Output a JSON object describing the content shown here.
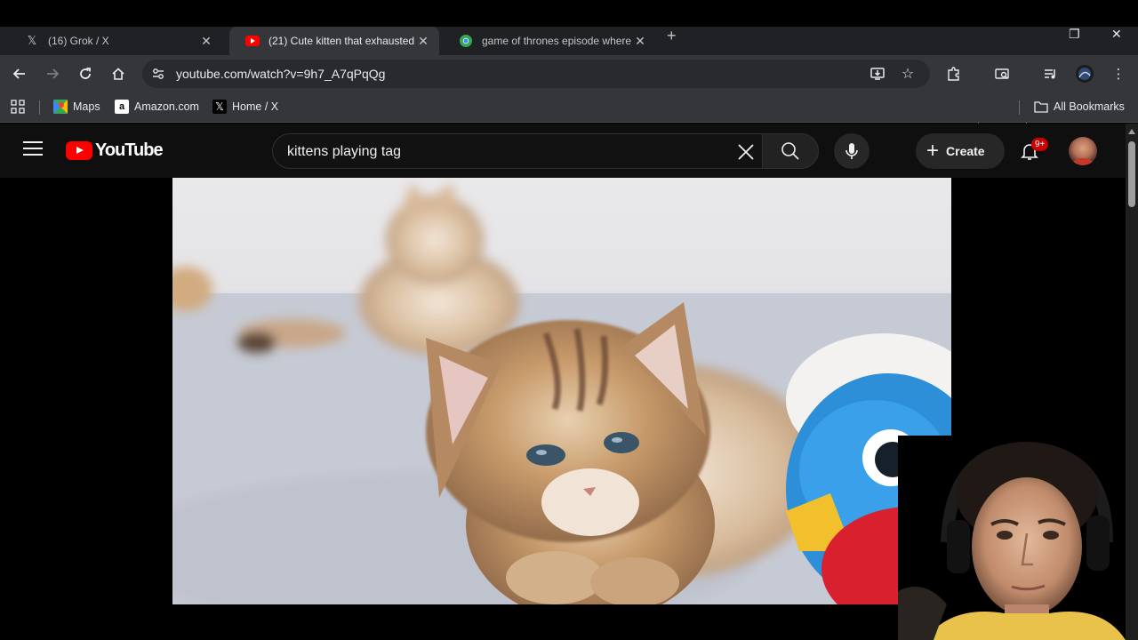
{
  "browser": {
    "tabs": [
      {
        "title": "(16) Grok / X",
        "favicon": "x-logo-icon",
        "active": false
      },
      {
        "title": "(21) Cute kitten that exhausted",
        "favicon": "youtube-icon",
        "active": true
      },
      {
        "title": "game of thrones episode where",
        "favicon": "chrome-icon",
        "active": false
      }
    ],
    "new_tab_label": "+",
    "url": "youtube.com/watch?v=9h7_A7qPqQg"
  },
  "bookmarks": {
    "items": [
      {
        "label": "Maps",
        "icon": "google-maps-icon"
      },
      {
        "label": "Amazon.com",
        "icon": "amazon-icon"
      },
      {
        "label": "Home / X",
        "icon": "x-logo-icon"
      }
    ],
    "all_bookmarks_label": "All Bookmarks"
  },
  "youtube": {
    "logo_text": "YouTube",
    "search_value": "kittens playing tag",
    "create_label": "Create",
    "notification_count": "9+",
    "colors": {
      "brand_red": "#ff0000",
      "masthead": "#0f0f0f",
      "badge": "#cc0000"
    }
  }
}
